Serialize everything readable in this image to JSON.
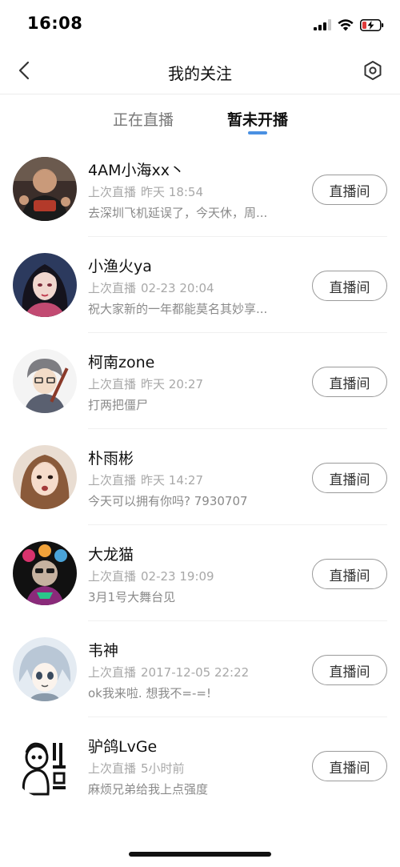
{
  "status_bar": {
    "time": "16:08"
  },
  "nav": {
    "title": "我的关注",
    "back_icon": "chevron-left-icon",
    "settings_icon": "hexagon-settings-icon"
  },
  "tabs": {
    "live": "正在直播",
    "offline": "暂未开播",
    "active": "offline",
    "accent_color": "#4a90e2"
  },
  "meta_prefix": "上次直播",
  "streamers": [
    {
      "name": "4AM小海xx丶",
      "last_live": "昨天 18:54",
      "desc": "去深圳飞机延误了，今天休，周...",
      "button": "直播间"
    },
    {
      "name": "小渔火ya",
      "last_live": "02-23 20:04",
      "desc": "祝大家新的一年都能莫名其妙享...",
      "button": "直播间"
    },
    {
      "name": "柯南zone",
      "last_live": "昨天 20:27",
      "desc": "打两把僵尸",
      "button": "直播间"
    },
    {
      "name": "朴雨彬",
      "last_live": "昨天 14:27",
      "desc": "今天可以拥有你吗? 7930707",
      "button": "直播间"
    },
    {
      "name": "大龙猫",
      "last_live": "02-23 19:09",
      "desc": "3月1号大舞台见",
      "button": "直播间"
    },
    {
      "name": "韦神",
      "last_live": "2017-12-05 22:22",
      "desc": "ok我来啦. 想我不=-=!",
      "button": "直播间"
    },
    {
      "name": "驴鸽LvGe",
      "last_live": "5小时前",
      "desc": "麻烦兄弟给我上点强度",
      "button": "直播间"
    }
  ]
}
